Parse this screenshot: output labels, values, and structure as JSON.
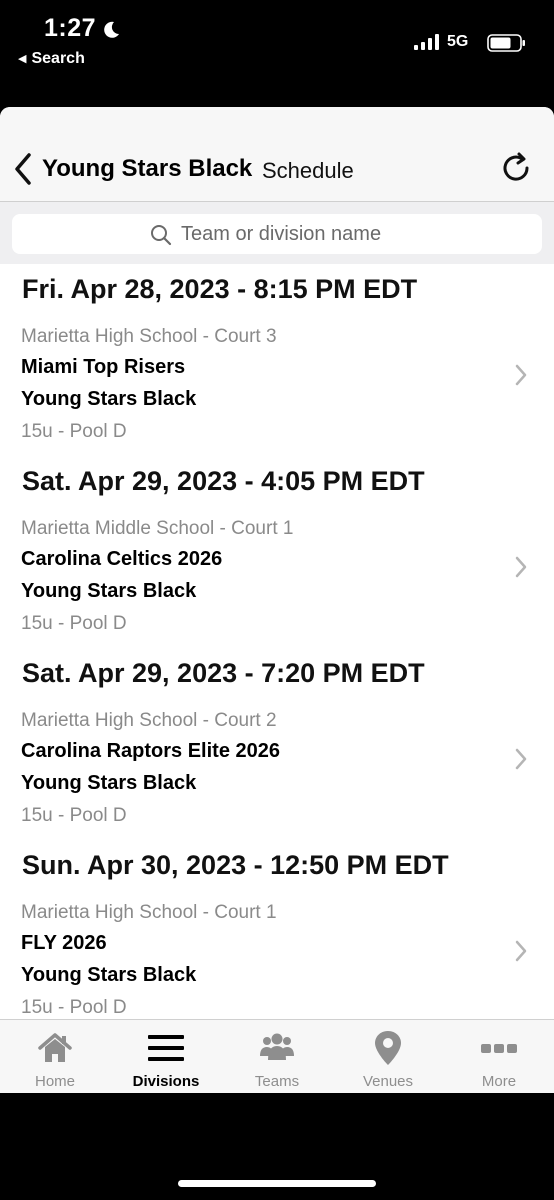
{
  "status_bar": {
    "time": "1:27",
    "back_app": "Search",
    "network": "5G"
  },
  "header": {
    "team": "Young Stars Black",
    "title": "Schedule"
  },
  "search": {
    "placeholder": "Team or division name"
  },
  "schedule": [
    {
      "date": "Fri. Apr 28, 2023 - 8:15 PM EDT",
      "venue": "Marietta High School - Court 3",
      "team1": "Miami Top Risers",
      "team2": "Young Stars Black",
      "pool": "15u - Pool D"
    },
    {
      "date": "Sat. Apr 29, 2023 - 4:05 PM EDT",
      "venue": "Marietta Middle School - Court 1",
      "team1": "Carolina Celtics 2026",
      "team2": "Young Stars Black",
      "pool": "15u - Pool D"
    },
    {
      "date": "Sat. Apr 29, 2023 - 7:20 PM EDT",
      "venue": "Marietta High School - Court 2",
      "team1": "Carolina Raptors Elite 2026",
      "team2": "Young Stars Black",
      "pool": "15u - Pool D"
    },
    {
      "date": "Sun. Apr 30, 2023 - 12:50 PM EDT",
      "venue": "Marietta High School - Court 1",
      "team1": "FLY 2026",
      "team2": "Young Stars Black",
      "pool": "15u - Pool D"
    }
  ],
  "tabs": [
    {
      "label": "Home",
      "icon": "home-icon",
      "active": false
    },
    {
      "label": "Divisions",
      "icon": "menu-icon",
      "active": true
    },
    {
      "label": "Teams",
      "icon": "people-icon",
      "active": false
    },
    {
      "label": "Venues",
      "icon": "map-pin-icon",
      "active": false
    },
    {
      "label": "More",
      "icon": "more-icon",
      "active": false
    }
  ],
  "colors": {
    "text_primary": "#000000",
    "text_secondary": "#8a8a8a",
    "tab_inactive": "#8e8e8e",
    "header_bg": "#f7f7f7"
  }
}
